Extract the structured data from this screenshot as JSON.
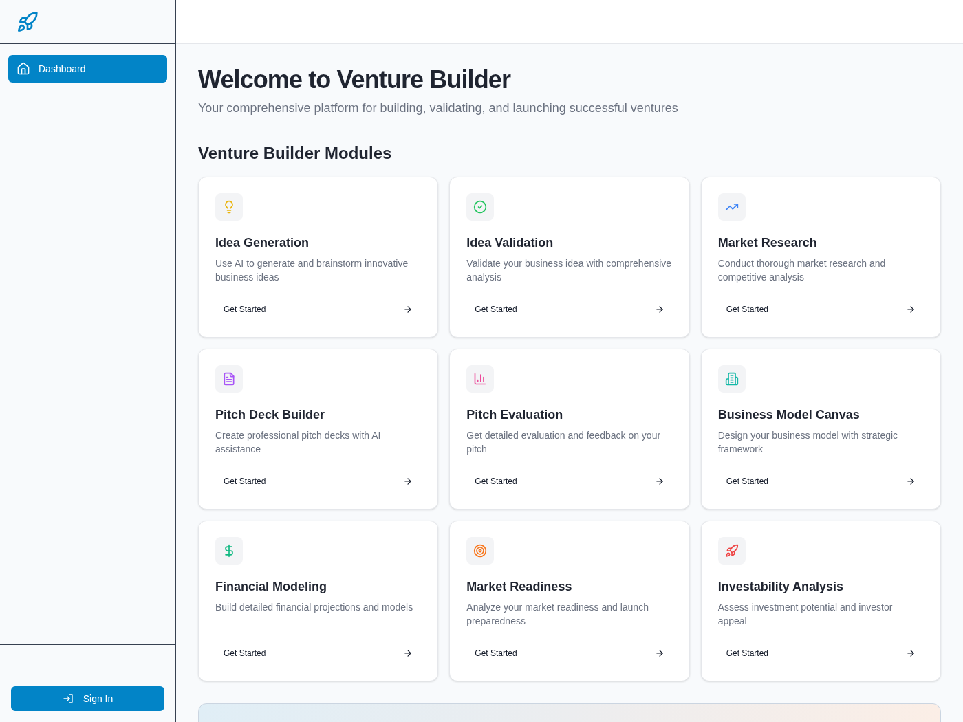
{
  "sidebar": {
    "nav": [
      {
        "label": "Dashboard",
        "selected": true
      }
    ],
    "sign_in": "Sign In"
  },
  "page": {
    "title": "Welcome to Venture Builder",
    "subtitle": "Your comprehensive platform for building, validating, and launching successful ventures",
    "section_title": "Venture Builder Modules"
  },
  "modules": [
    {
      "title": "Idea Generation",
      "description": "Use AI to generate and brainstorm innovative business ideas",
      "action": "Get Started",
      "color": "#eab308"
    },
    {
      "title": "Idea Validation",
      "description": "Validate your business idea with comprehensive analysis",
      "action": "Get Started",
      "color": "#22c55e"
    },
    {
      "title": "Market Research",
      "description": "Conduct thorough market research and competitive analysis",
      "action": "Get Started",
      "color": "#3b82f6"
    },
    {
      "title": "Pitch Deck Builder",
      "description": "Create professional pitch decks with AI assistance",
      "action": "Get Started",
      "color": "#a855f7"
    },
    {
      "title": "Pitch Evaluation",
      "description": "Get detailed evaluation and feedback on your pitch",
      "action": "Get Started",
      "color": "#ec4899"
    },
    {
      "title": "Business Model Canvas",
      "description": "Design your business model with strategic framework",
      "action": "Get Started",
      "color": "#14b8a6"
    },
    {
      "title": "Financial Modeling",
      "description": "Build detailed financial projections and models",
      "action": "Get Started",
      "color": "#10b981"
    },
    {
      "title": "Market Readiness",
      "description": "Analyze your market readiness and launch preparedness",
      "action": "Get Started",
      "color": "#f97316"
    },
    {
      "title": "Investability Analysis",
      "description": "Assess investment potential and investor appeal",
      "action": "Get Started",
      "color": "#ef4444"
    }
  ]
}
